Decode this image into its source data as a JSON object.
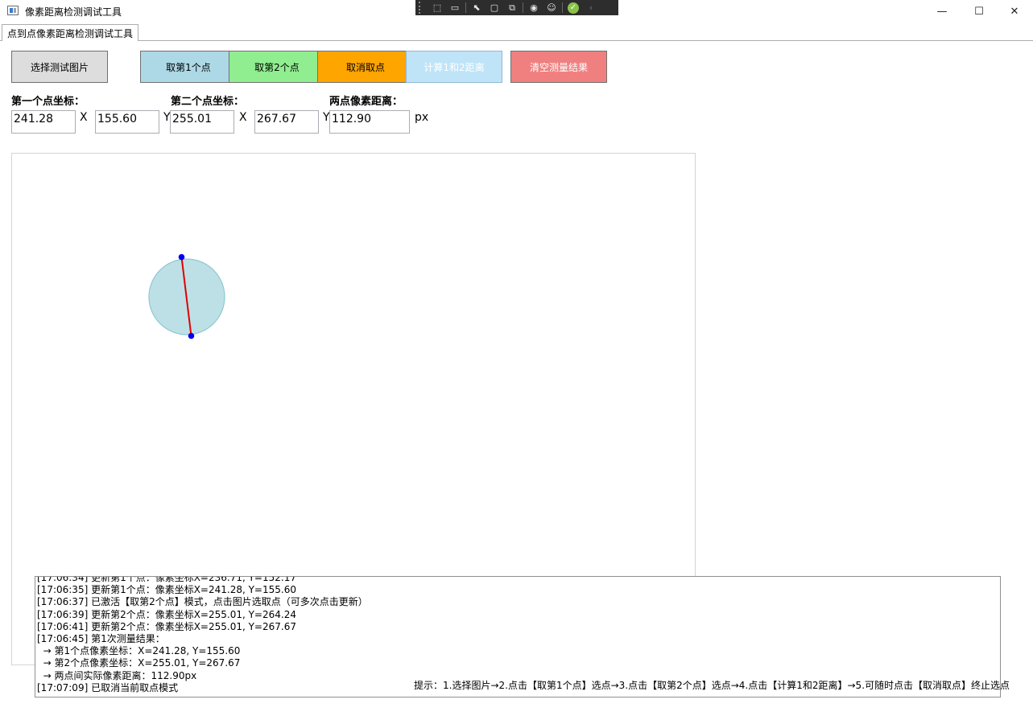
{
  "window": {
    "title": "像素距离检测调试工具",
    "controls": {
      "minimize": "—",
      "maximize": "☐",
      "close": "✕"
    }
  },
  "debug_toolbar": {
    "icons": [
      "select-element-icon",
      "camera-icon",
      "cursor-icon",
      "frame-icon",
      "preview-icon",
      "hot-reload-icon",
      "accessibility-icon",
      "check-icon",
      "chevron-left-icon"
    ]
  },
  "tab": {
    "label": "点到点像素距离检测调试工具"
  },
  "buttons": {
    "select_image": {
      "label": "选择测试图片",
      "bg": "#dddddd"
    },
    "pick_point1": {
      "label": "取第1个点",
      "bg": "#add8e6"
    },
    "pick_point2": {
      "label": "取第2个点",
      "bg": "#90ee90"
    },
    "cancel_pick": {
      "label": "取消取点",
      "bg": "#ffa500"
    },
    "compute": {
      "label": "计算1和2距离",
      "bg": "#bfe4f7",
      "fg": "#ffffff"
    },
    "clear": {
      "label": "清空测量结果",
      "bg": "#f08080",
      "fg": "#ffffff"
    }
  },
  "point1": {
    "label": "第一个点坐标：",
    "x": "241.28",
    "x_unit": "X",
    "y": "155.60",
    "y_unit": "Y"
  },
  "point2": {
    "label": "第二个点坐标：",
    "x": "255.01",
    "x_unit": "X",
    "y": "267.67",
    "y_unit": "Y"
  },
  "distance": {
    "label": "两点像素距离：",
    "value": "112.90",
    "unit": "px"
  },
  "colors": {
    "circle_fill": "#bde0e6",
    "circle_stroke": "#8ec8d2",
    "line": "#e00000",
    "point": "#0000ee"
  },
  "log": {
    "lines": [
      "[17:06:34] 更新第1个点：像素坐标X=236.71, Y=152.17",
      "[17:06:35] 更新第1个点：像素坐标X=241.28, Y=155.60",
      "[17:06:37] 已激活【取第2个点】模式，点击图片选取点（可多次点击更新）",
      "[17:06:39] 更新第2个点：像素坐标X=255.01, Y=264.24",
      "[17:06:41] 更新第2个点：像素坐标X=255.01, Y=267.67",
      "[17:06:45] 第1次测量结果：",
      "  → 第1个点像素坐标：X=241.28, Y=155.60",
      "  → 第2个点像素坐标：X=255.01, Y=267.67",
      "  → 两点间实际像素距离：112.90px",
      "[17:07:09] 已取消当前取点模式"
    ]
  },
  "hint": "提示：1.选择图片→2.点击【取第1个点】选点→3.点击【取第2个点】选点→4.点击【计算1和2距离】→5.可随时点击【取消取点】终止选点"
}
